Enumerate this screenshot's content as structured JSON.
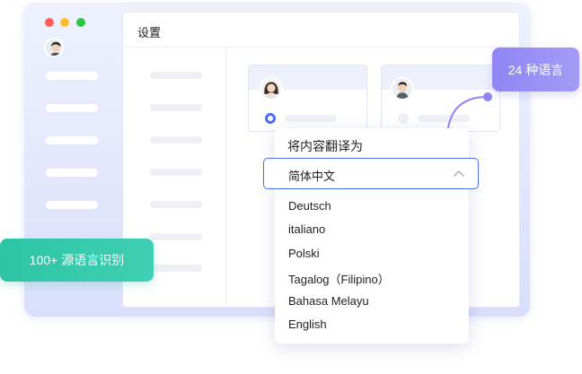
{
  "window": {
    "panel_title": "设置"
  },
  "popup": {
    "title": "将内容翻译为",
    "selected": "简体中文",
    "options": [
      "Deutsch",
      "italiano",
      "Polski",
      "Tagalog（Filipino）",
      "Bahasa Melayu",
      "English"
    ]
  },
  "badges": {
    "source": "100+ 源语言识别",
    "target": "24 种语言"
  },
  "icons": {
    "chevron": "chevron-up-icon",
    "avatar": "avatar-icon"
  },
  "colors": {
    "accent": "#4a6cf7",
    "green_badge": "#2ec4a6",
    "purple_badge": "#9a90f5"
  }
}
